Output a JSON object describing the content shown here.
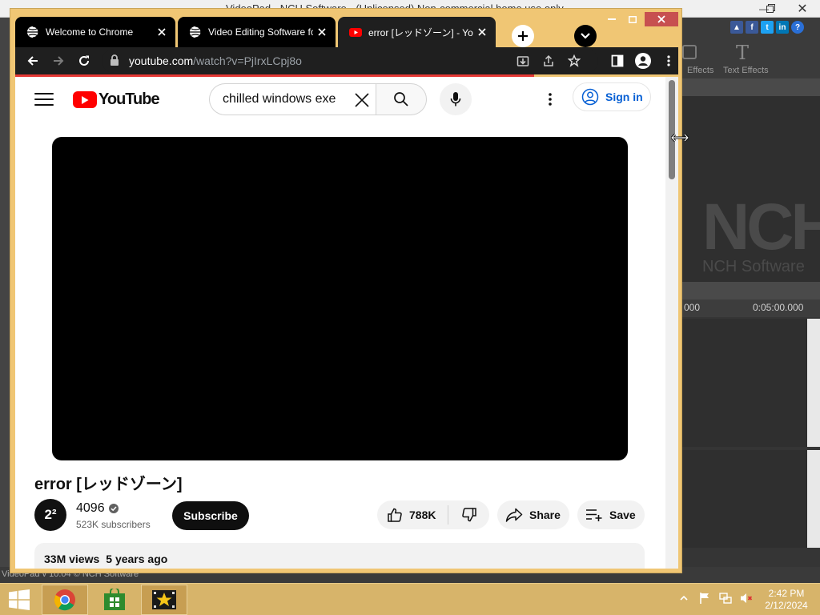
{
  "background_app": {
    "title": "VideoPad - NCH Software - (Unlicensed) Non-commercial home use only",
    "effects_label": "Effects",
    "text_effects_label": "Text Effects",
    "logo_text": "NCH",
    "logo_subtext": "NCH Software",
    "timeline_marks": [
      "000",
      "0:05:00.000"
    ],
    "status_text": "VideoPad v 10.04 © NCH Software"
  },
  "browser": {
    "tabs": [
      {
        "title": "Welcome to Chrome",
        "favicon": "chrome-globe-icon",
        "active": false
      },
      {
        "title": "Video Editing Software for",
        "favicon": "chrome-globe-icon",
        "active": false
      },
      {
        "title": "error [レッドゾーン] - YouTube",
        "favicon": "youtube-icon",
        "active": true
      }
    ],
    "url_host": "youtube.com",
    "url_path": "/watch?v=PjIrxLCpj8o",
    "accent_color": "#e53935"
  },
  "youtube": {
    "logo_text": "YouTube",
    "search_value": "chilled windows exe",
    "signin_label": "Sign in",
    "video_title": "error [レッドゾーン]",
    "channel": {
      "name": "4096",
      "avatar_text": "2²",
      "subscribers": "523K subscribers"
    },
    "subscribe_label": "Subscribe",
    "like_count": "788K",
    "share_label": "Share",
    "save_label": "Save",
    "views": "33M views",
    "published": "5 years ago"
  },
  "taskbar": {
    "apps": [
      "chrome-icon",
      "store-icon",
      "videopad-icon"
    ],
    "time": "2:42 PM",
    "date": "2/12/2024"
  }
}
